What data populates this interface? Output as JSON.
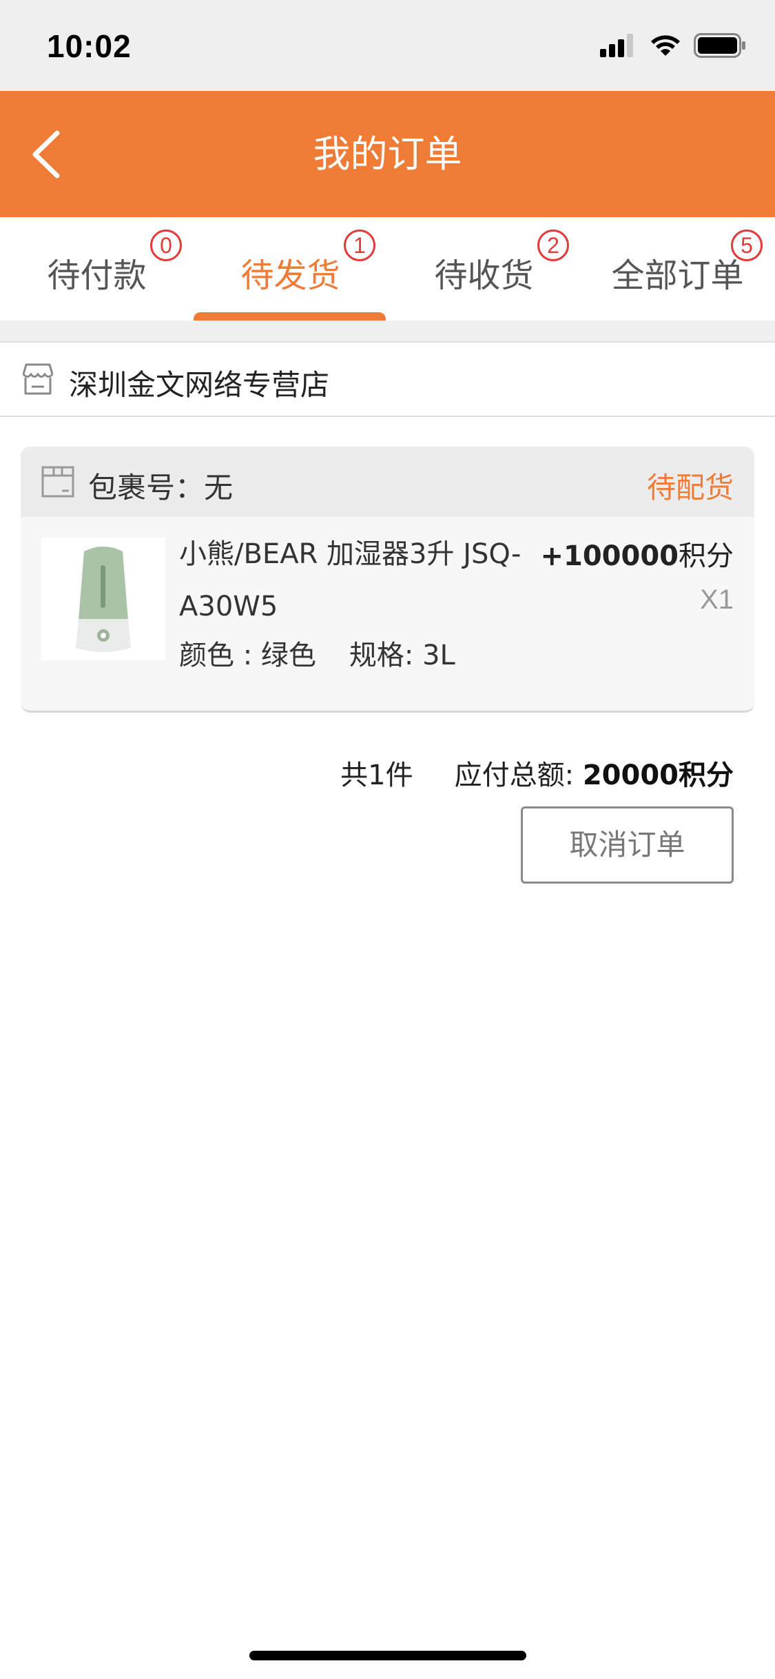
{
  "status_bar": {
    "time": "10:02"
  },
  "nav": {
    "title": "我的订单"
  },
  "tabs": [
    {
      "label": "待付款",
      "badge": "0"
    },
    {
      "label": "待发货",
      "badge": "1",
      "active": true
    },
    {
      "label": "待收货",
      "badge": "2"
    },
    {
      "label": "全部订单",
      "badge": "5"
    }
  ],
  "shop": {
    "name": "深圳金文网络专营店"
  },
  "order": {
    "package_label": "包裹号：无",
    "status": "待配货",
    "product": {
      "name": "小熊/BEAR 加湿器3升 JSQ-A30W5",
      "color_attr": "颜色 : 绿色",
      "spec_attr": "规格: 3L",
      "price_prefix": "+",
      "price_value": "100000",
      "price_unit": "积分",
      "qty": "X1"
    }
  },
  "summary": {
    "count": "共1件",
    "total_label": "应付总额:",
    "total_value": "20000积分"
  },
  "actions": {
    "cancel_label": "取消订单"
  },
  "colors": {
    "accent": "#ee7b36",
    "badge": "#e33a3a"
  }
}
